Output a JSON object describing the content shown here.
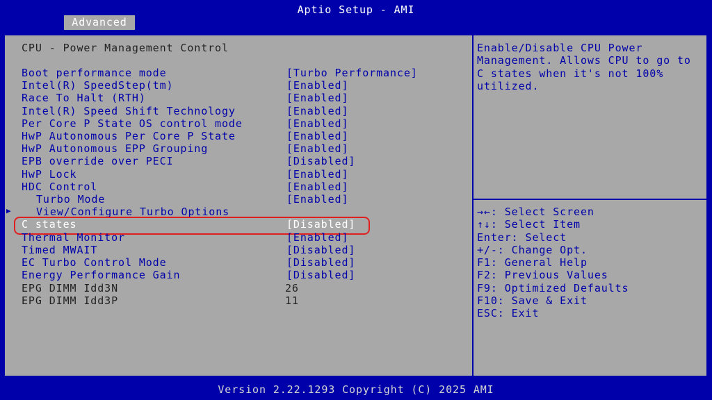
{
  "header": {
    "title": "Aptio Setup - AMI",
    "tabs": [
      {
        "label": "Advanced"
      }
    ]
  },
  "section_title": "CPU - Power Management Control",
  "settings": [
    {
      "label": "Boot performance mode",
      "value": "[Turbo Performance]"
    },
    {
      "label": "Intel(R) SpeedStep(tm)",
      "value": "[Enabled]"
    },
    {
      "label": "Race To Halt (RTH)",
      "value": "[Enabled]"
    },
    {
      "label": "Intel(R) Speed Shift Technology",
      "value": "[Enabled]"
    },
    {
      "label": "Per Core P State OS control mode",
      "value": "[Enabled]"
    },
    {
      "label": "HwP Autonomous Per Core P State",
      "value": "[Enabled]"
    },
    {
      "label": "HwP Autonomous EPP Grouping",
      "value": "[Enabled]"
    },
    {
      "label": "EPB override over PECI",
      "value": "[Disabled]"
    },
    {
      "label": "HwP Lock",
      "value": "[Enabled]"
    },
    {
      "label": "HDC Control",
      "value": "[Enabled]"
    },
    {
      "label": "Turbo Mode",
      "value": "[Enabled]"
    },
    {
      "label": "View/Configure Turbo Options",
      "value": ""
    },
    {
      "label": "C states",
      "value": "[Disabled]"
    },
    {
      "label": "Thermal Monitor",
      "value": "[Enabled]"
    },
    {
      "label": "Timed MWAIT",
      "value": "[Disabled]"
    },
    {
      "label": "EC Turbo Control Mode",
      "value": "[Disabled]"
    },
    {
      "label": "Energy Performance Gain",
      "value": "[Disabled]"
    },
    {
      "label": "EPG DIMM Idd3N",
      "value": "26"
    },
    {
      "label": "EPG DIMM Idd3P",
      "value": "11"
    }
  ],
  "selected_item": "C states",
  "help": {
    "text": "Enable/Disable CPU Power Management. Allows CPU to go to C states when it's not 100% utilized."
  },
  "key_help": [
    "→←: Select Screen",
    "↑↓: Select Item",
    "Enter: Select",
    "+/-: Change Opt.",
    "F1: General Help",
    "F2: Previous Values",
    "F9: Optimized Defaults",
    "F10: Save & Exit",
    "ESC: Exit"
  ],
  "footer": {
    "text": "Version 2.22.1293 Copyright (C) 2025 AMI"
  },
  "colors": {
    "background": "#0000aa",
    "panel": "#a8a8a8",
    "item_text": "#0000aa",
    "selected_text": "#ffffff",
    "static_text": "#222222",
    "highlight_ring": "#e02020"
  }
}
